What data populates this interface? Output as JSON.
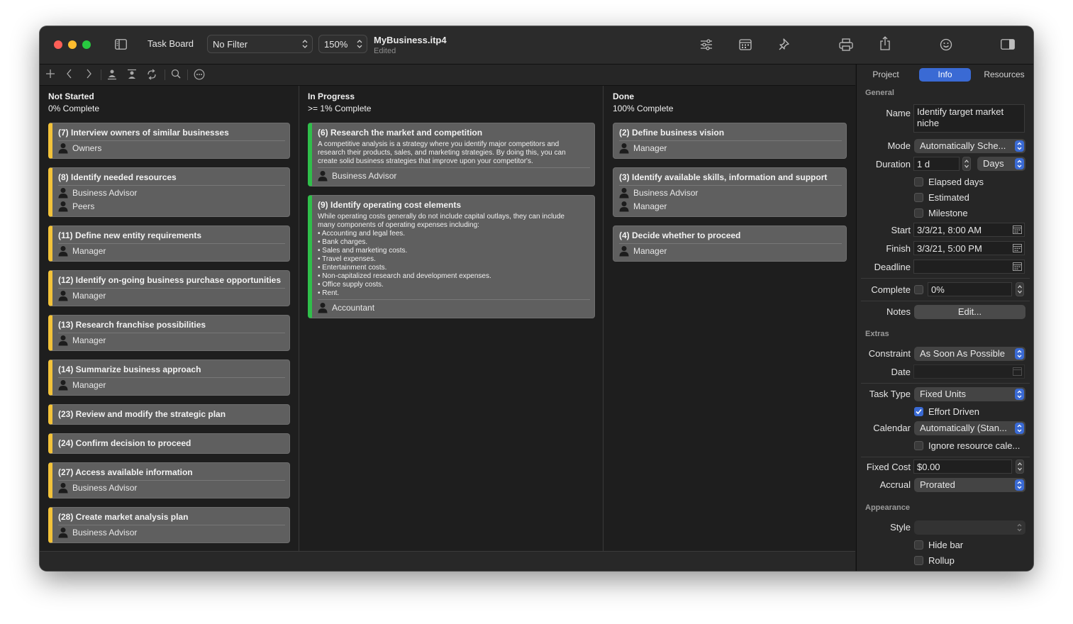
{
  "titlebar": {
    "view_label": "Task Board",
    "filter_value": "No Filter",
    "zoom_value": "150%",
    "document_title": "MyBusiness.itp4",
    "document_status": "Edited"
  },
  "columns": [
    {
      "title": "Not Started",
      "subtitle": "0% Complete"
    },
    {
      "title": "In Progress",
      "subtitle": ">= 1% Complete"
    },
    {
      "title": "Done",
      "subtitle": "100% Complete"
    }
  ],
  "cards": {
    "not_started": [
      {
        "title": "(7) Interview owners of similar businesses",
        "resources": [
          "Owners"
        ]
      },
      {
        "title": "(8) Identify needed resources",
        "resources": [
          "Business Advisor",
          "Peers"
        ]
      },
      {
        "title": "(11) Define new entity requirements",
        "resources": [
          "Manager"
        ]
      },
      {
        "title": "(12) Identify on-going business purchase opportunities",
        "resources": [
          "Manager"
        ]
      },
      {
        "title": "(13) Research franchise possibilities",
        "resources": [
          "Manager"
        ]
      },
      {
        "title": "(14) Summarize business approach",
        "resources": [
          "Manager"
        ]
      },
      {
        "title": "(23) Review and modify the strategic plan",
        "resources": []
      },
      {
        "title": "(24) Confirm decision to proceed",
        "resources": []
      },
      {
        "title": "(27) Access available information",
        "resources": [
          "Business Advisor"
        ]
      },
      {
        "title": "(28) Create market analysis plan",
        "resources": [
          "Business Advisor"
        ]
      }
    ],
    "in_progress": [
      {
        "title": "(6) Research the market and competition",
        "description": [
          "A competitive analysis is a strategy where you identify major competitors and",
          "research their products, sales, and marketing strategies. By doing this, you can",
          "create solid business strategies that improve upon your competitor's."
        ],
        "resources": [
          "Business Advisor"
        ]
      },
      {
        "title": "(9) Identify operating cost elements",
        "description": [
          "While operating costs generally do not include capital outlays, they can include",
          "many components of operating expenses including:",
          "• Accounting and legal fees.",
          "• Bank charges.",
          "• Sales and marketing costs.",
          "• Travel expenses.",
          "• Entertainment costs.",
          "• Non-capitalized research and development expenses.",
          "• Office supply costs.",
          "• Rent."
        ],
        "resources": [
          "Accountant"
        ]
      }
    ],
    "done": [
      {
        "title": "(2) Define business vision",
        "resources": [
          "Manager"
        ]
      },
      {
        "title": "(3) Identify available skills, information and support",
        "resources": [
          "Business Advisor",
          "Manager"
        ]
      },
      {
        "title": "(4) Decide whether to proceed",
        "resources": [
          "Manager"
        ]
      }
    ]
  },
  "inspector": {
    "tabs": [
      "Project",
      "Info",
      "Resources"
    ],
    "active_tab": "Info",
    "sections": {
      "general": "General",
      "extras": "Extras",
      "appearance": "Appearance"
    },
    "labels": {
      "name": "Name",
      "mode": "Mode",
      "duration": "Duration",
      "start": "Start",
      "finish": "Finish",
      "deadline": "Deadline",
      "complete": "Complete",
      "notes": "Notes",
      "constraint": "Constraint",
      "date": "Date",
      "task_type": "Task Type",
      "calendar": "Calendar",
      "fixed_cost": "Fixed Cost",
      "accrual": "Accrual",
      "style": "Style"
    },
    "values": {
      "name_line1": "Identify target market",
      "name_line2": "niche",
      "mode": "Automatically Sche...",
      "duration": "1 d",
      "duration_unit": "Days",
      "start": "3/3/21, 8:00 AM",
      "finish": "3/3/21, 5:00 PM",
      "deadline": "",
      "complete": "0%",
      "notes_button": "Edit...",
      "constraint": "As Soon As Possible",
      "date": "",
      "task_type": "Fixed Units",
      "calendar": "Automatically (Stan...",
      "fixed_cost": "$0.00",
      "accrual": "Prorated",
      "style": ""
    },
    "checkboxes": {
      "elapsed_days": {
        "label": "Elapsed days",
        "checked": false
      },
      "estimated": {
        "label": "Estimated",
        "checked": false
      },
      "milestone": {
        "label": "Milestone",
        "checked": false
      },
      "effort_driven": {
        "label": "Effort Driven",
        "checked": true
      },
      "ignore_resource_calendar": {
        "label": "Ignore resource cale...",
        "checked": false
      },
      "hide_bar": {
        "label": "Hide bar",
        "checked": false
      },
      "rollup": {
        "label": "Rollup",
        "checked": false
      }
    }
  },
  "colors": {
    "not_started_accent": "#f2c23a",
    "in_progress_accent": "#2fbf4a",
    "selection_accent": "#3a6ad4"
  }
}
